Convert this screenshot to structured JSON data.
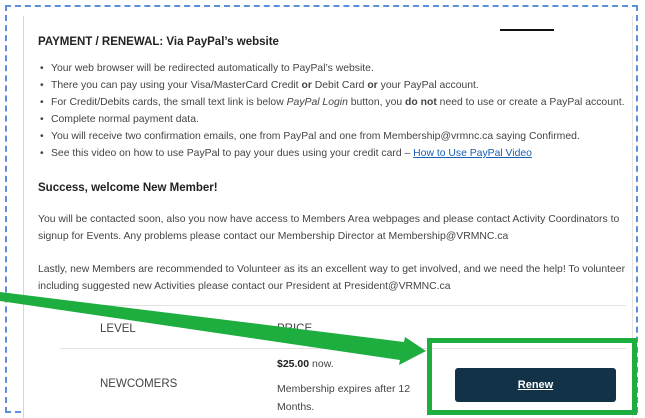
{
  "payment": {
    "heading": "PAYMENT / RENEWAL: Via PayPal’s website",
    "bullets": [
      {
        "text": "Your web browser will be redirected automatically to PayPal’s website."
      },
      {
        "pre": "There you can pay using your Visa/MasterCard Credit ",
        "b1": "or",
        "mid": " Debit Card ",
        "b2": "or",
        "post": " your PayPal account."
      },
      {
        "pre": "For Credit/Debits cards, the small text link is below ",
        "italic": "PayPal Login",
        "mid": " button, you ",
        "bold": "do not",
        "post": " need to use or create a PayPal account."
      },
      {
        "text": "Complete normal payment data."
      },
      {
        "text": "You will receive two confirmation emails, one from PayPal and one from Membership@vrmnc.ca saying Confirmed."
      },
      {
        "pre": "See this video on how to use PayPal to pay your dues using your credit card – ",
        "link": "How to Use PayPal Video"
      }
    ]
  },
  "success": {
    "heading": "Success, welcome New Member!",
    "para1": "You will be contacted soon, also you now have access to Members Area webpages and please contact Activity Coordinators to signup for Events. Any problems please contact our Membership Director at Membership@VRMNC.ca",
    "para2": "Lastly, new Members are recommended to Volunteer as its an excellent way to get involved, and we need the help! To volunteer including suggested new Activities please contact our President at President@VRMNC.ca"
  },
  "table": {
    "headers": {
      "level": "LEVEL",
      "price": "PRICE"
    },
    "row": {
      "level": "NEWCOMERS",
      "price_amount": "$25.00",
      "price_suffix": " now.",
      "note": "Membership expires after 12 Months.",
      "button": "Renew"
    }
  },
  "colors": {
    "highlight": "#1dae3f",
    "button": "#113247",
    "link": "#1a5fb4",
    "frame": "#5b8fd9"
  }
}
